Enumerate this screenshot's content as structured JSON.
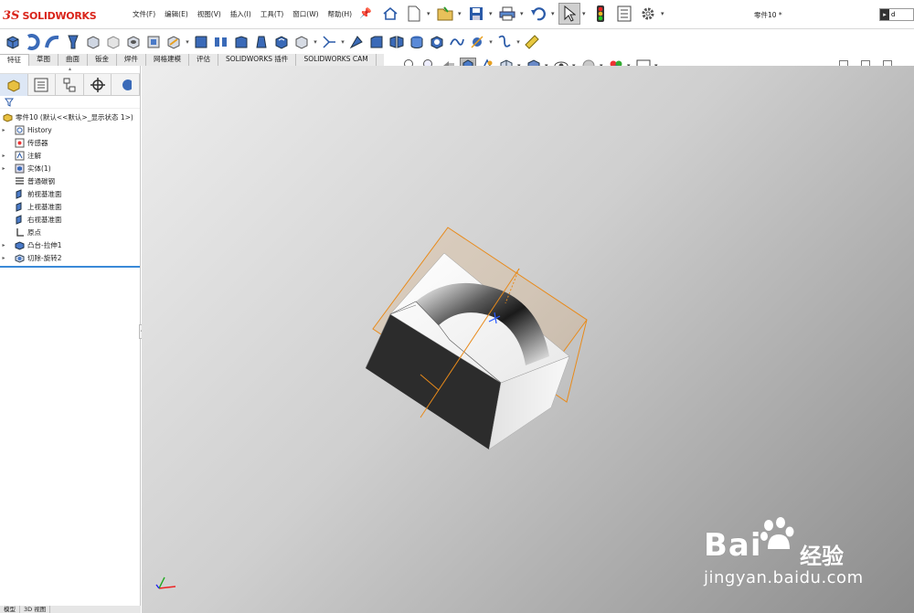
{
  "app": {
    "logo_symbol": "3S",
    "logo_text": "SOLIDWORKS",
    "brand_color": "#d9241a"
  },
  "menu": {
    "items": [
      "文件(F)",
      "编辑(E)",
      "视图(V)",
      "插入(I)",
      "工具(T)",
      "窗口(W)",
      "帮助(H)"
    ]
  },
  "document": {
    "title": "零件10 *"
  },
  "search": {
    "value": "d"
  },
  "tabs": [
    "特征",
    "草图",
    "曲面",
    "钣金",
    "焊件",
    "网格建模",
    "评估",
    "SOLIDWORKS 插件",
    "SOLIDWORKS CAM"
  ],
  "active_tab": "特征",
  "feature_tree": {
    "root": "零件10  (默认<<默认>_显示状态 1>)",
    "items": [
      {
        "label": "History",
        "icon": "history-icon",
        "expandable": true
      },
      {
        "label": "传感器",
        "icon": "sensor-icon",
        "expandable": false
      },
      {
        "label": "注解",
        "icon": "annotation-icon",
        "expandable": true
      },
      {
        "label": "实体(1)",
        "icon": "solid-bodies-icon",
        "expandable": true
      },
      {
        "label": "普通碳钢",
        "icon": "material-icon",
        "expandable": false
      },
      {
        "label": "前视基准面",
        "icon": "plane-icon",
        "expandable": false
      },
      {
        "label": "上视基准面",
        "icon": "plane-icon",
        "expandable": false
      },
      {
        "label": "右视基准面",
        "icon": "plane-icon",
        "expandable": false
      },
      {
        "label": "原点",
        "icon": "origin-icon",
        "expandable": false
      },
      {
        "label": "凸台-拉伸1",
        "icon": "extrude-icon",
        "expandable": true
      },
      {
        "label": "切除-旋转2",
        "icon": "cut-revolve-icon",
        "expandable": true
      }
    ]
  },
  "bottom_tabs": [
    "模型",
    "3D 视图"
  ],
  "watermark": {
    "brand": "Bai",
    "brand2": "经验",
    "url": "jingyan.baidu.com"
  },
  "colors": {
    "plane_orange": "#e88a1a",
    "selection_blue": "#3a8ad8"
  }
}
